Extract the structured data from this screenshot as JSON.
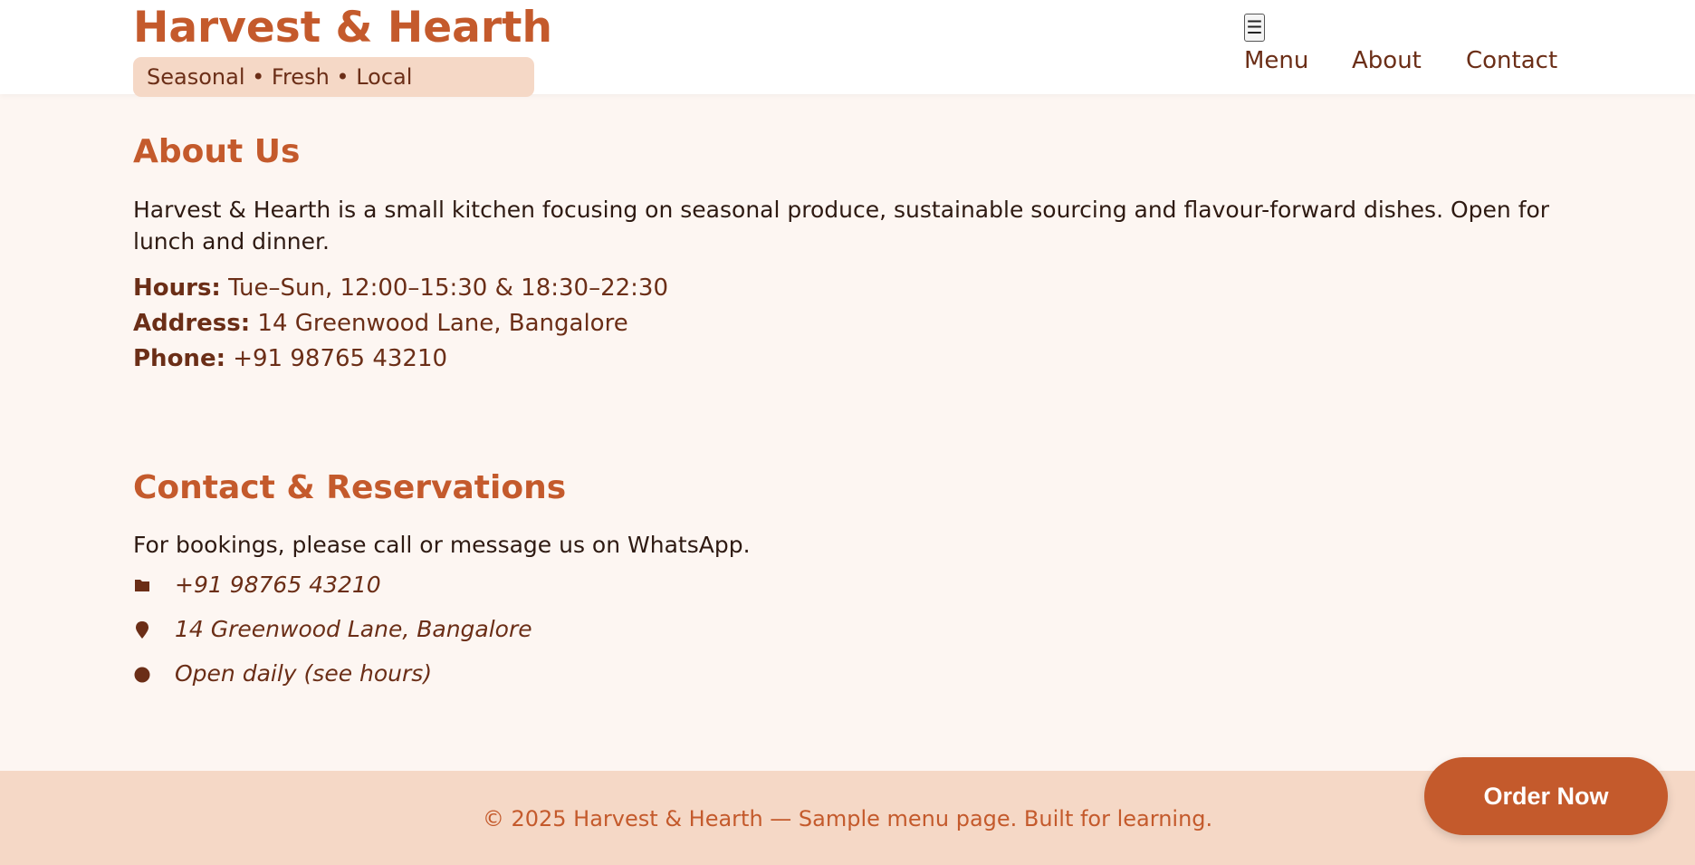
{
  "header": {
    "brand_title": "Harvest & Hearth",
    "tagline": "Seasonal • Fresh • Local",
    "menu_toggle_icon": "☰",
    "nav": {
      "menu": "Menu",
      "about": "About",
      "contact": "Contact"
    }
  },
  "about": {
    "heading": "About Us",
    "description": "Harvest & Hearth is a small kitchen focusing on seasonal produce, sustainable sourcing and flavour-forward dishes. Open for lunch and dinner.",
    "hours_label": "Hours:",
    "hours_value": "Tue–Sun, 12:00–15:30 & 18:30–22:30",
    "address_label": "Address:",
    "address_value": "14 Greenwood Lane, Bangalore",
    "phone_label": "Phone:",
    "phone_value": "+91 98765 43210"
  },
  "contact": {
    "heading": "Contact & Reservations",
    "intro": "For bookings, please call or message us on WhatsApp.",
    "items": [
      {
        "icon": "phone-icon",
        "text": "+91 98765 43210"
      },
      {
        "icon": "location-pin-icon",
        "text": "14 Greenwood Lane, Bangalore"
      },
      {
        "icon": "clock-icon",
        "text": "Open daily (see hours)"
      }
    ]
  },
  "footer": {
    "text": "© 2025 Harvest & Hearth — Sample menu page. Built for learning."
  },
  "order_button": {
    "label": "Order Now"
  },
  "colors": {
    "accent": "#c45a2c",
    "dark_brown": "#6b2e17",
    "tagline_bg": "#f5d8c6",
    "page_bg": "#fdf6f2",
    "header_bg": "#ffffff"
  }
}
